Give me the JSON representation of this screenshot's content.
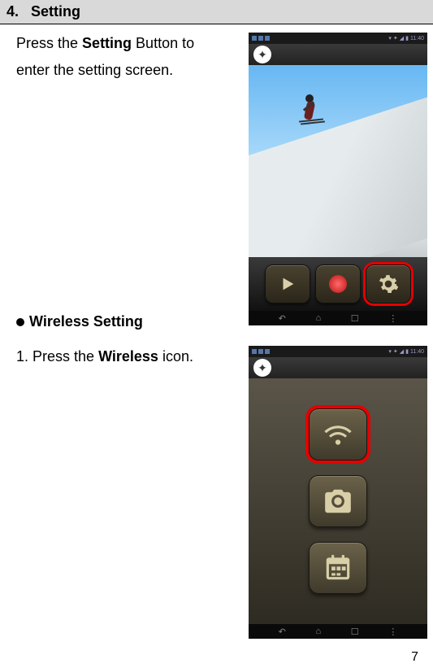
{
  "section": {
    "number": "4.",
    "title": "Setting"
  },
  "intro": {
    "prefix": "Press the ",
    "button_name": "Setting",
    "suffix1": " Button to",
    "line2": "enter the setting screen."
  },
  "wireless_heading": "Wireless Setting",
  "step1": {
    "prefix": "1. Press the ",
    "icon_name": "Wireless",
    "suffix": " icon."
  },
  "statusbar": {
    "time": "11:40"
  },
  "page_number": "7"
}
